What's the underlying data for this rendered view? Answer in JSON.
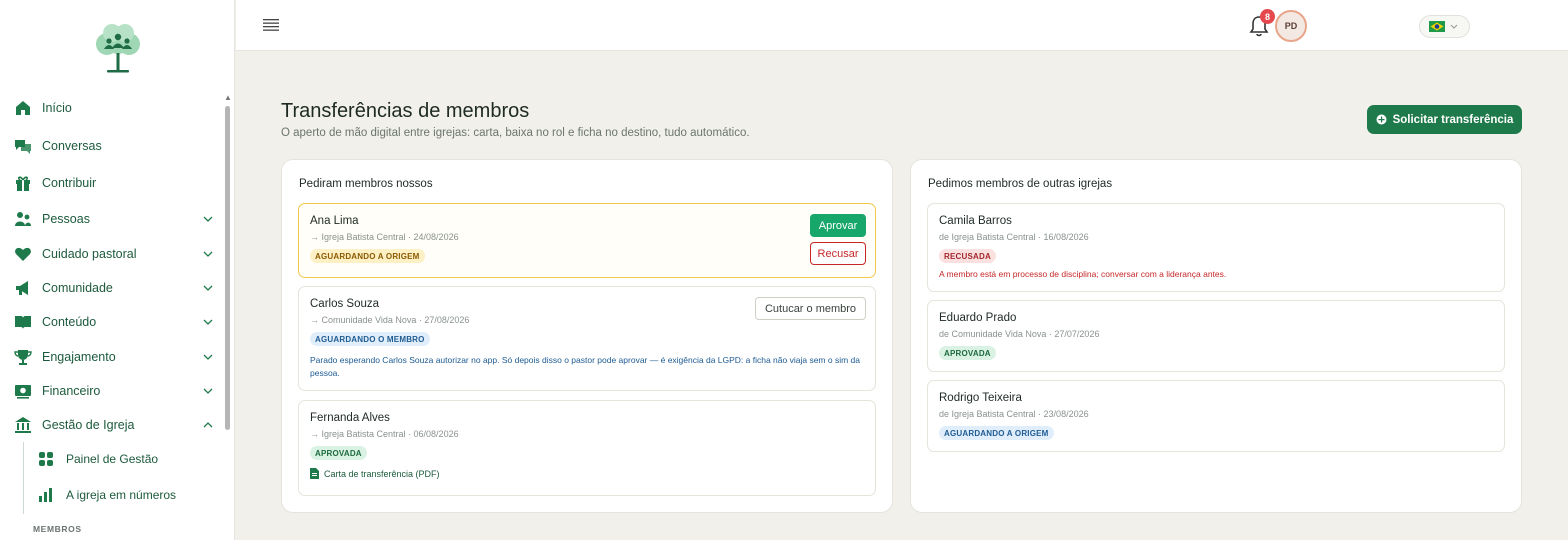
{
  "sidebar": {
    "items": [
      {
        "label": "Início",
        "icon": "home-icon"
      },
      {
        "label": "Conversas",
        "icon": "chat-icon"
      },
      {
        "label": "Contribuir",
        "icon": "gift-icon"
      },
      {
        "label": "Pessoas",
        "icon": "people-icon"
      },
      {
        "label": "Cuidado pastoral",
        "icon": "heart-icon"
      },
      {
        "label": "Comunidade",
        "icon": "megaphone-icon"
      },
      {
        "label": "Conteúdo",
        "icon": "book-icon"
      },
      {
        "label": "Engajamento",
        "icon": "trophy-icon"
      },
      {
        "label": "Financeiro",
        "icon": "money-icon"
      },
      {
        "label": "Gestão de Igreja",
        "icon": "bank-icon"
      }
    ],
    "subitems": [
      {
        "label": "Painel de Gestão",
        "icon": "grid-icon"
      },
      {
        "label": "A igreja em números",
        "icon": "bar-chart-icon"
      }
    ],
    "section_label": "MEMBROS"
  },
  "topbar": {
    "notifications_count": "8",
    "avatar_initials": "PD",
    "language_flag": "brazil-flag-icon"
  },
  "header": {
    "title": "Transferências de membros",
    "subtitle": "O aperto de mão digital entre igrejas: carta, baixa no rol e ficha no destino, tudo automático.",
    "primary_button": "Solicitar transferência"
  },
  "left_panel": {
    "title": "Pediram membros nossos",
    "cards": [
      {
        "name": "Ana Lima",
        "meta": "→ Igreja Batista Central · 24/08/2026",
        "status": "AGUARDANDO A ORIGEM",
        "approve": "Aprovar",
        "reject": "Recusar"
      },
      {
        "name": "Carlos Souza",
        "meta": "→ Comunidade Vida Nova · 27/08/2026",
        "status": "AGUARDANDO O MEMBRO",
        "action": "Cutucar o membro",
        "note": "Parado esperando Carlos Souza autorizar no app. Só depois disso o pastor pode aprovar — é exigência da LGPD: a ficha não viaja sem o sim da pessoa."
      },
      {
        "name": "Fernanda Alves",
        "meta": "→ Igreja Batista Central · 06/08/2026",
        "status": "APROVADA",
        "link": "Carta de transferência (PDF)"
      }
    ]
  },
  "right_panel": {
    "title": "Pedimos membros de outras igrejas",
    "cards": [
      {
        "name": "Camila Barros",
        "meta": "de Igreja Batista Central · 16/08/2026",
        "status": "RECUSADA",
        "note": "A membro está em processo de disciplina; conversar com a liderança antes."
      },
      {
        "name": "Eduardo Prado",
        "meta": "de Comunidade Vida Nova · 27/07/2026",
        "status": "APROVADA"
      },
      {
        "name": "Rodrigo Teixeira",
        "meta": "de Igreja Batista Central · 23/08/2026",
        "status": "AGUARDANDO A ORIGEM"
      }
    ]
  },
  "colors": {
    "brand": "#1e7a4a",
    "approve": "#17a76a",
    "danger": "#c62828",
    "highlight_border": "#f0c84e"
  }
}
